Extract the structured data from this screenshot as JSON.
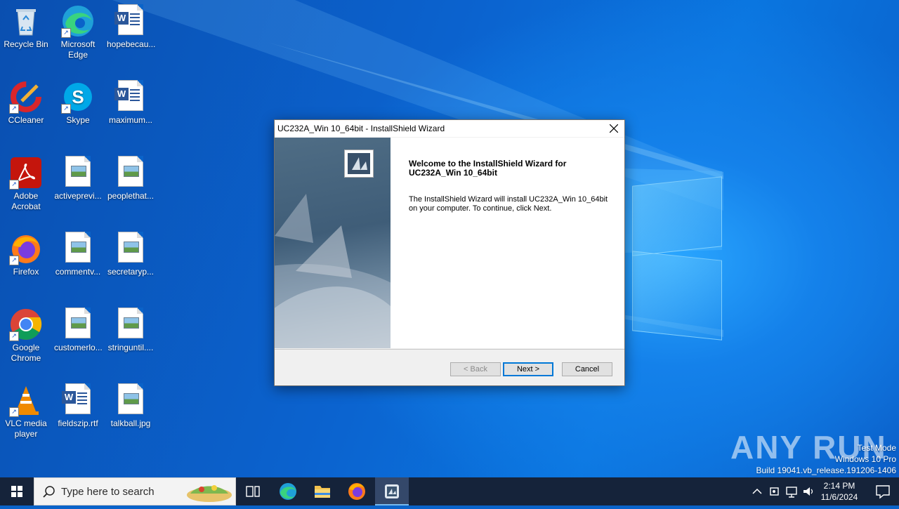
{
  "desktop": {
    "icons": [
      {
        "label": "Recycle Bin"
      },
      {
        "label": "Microsoft Edge"
      },
      {
        "label": "hopebecau..."
      },
      {
        "label": "CCleaner"
      },
      {
        "label": "Skype"
      },
      {
        "label": "maximum..."
      },
      {
        "label": "Adobe Acrobat"
      },
      {
        "label": "activeprevi..."
      },
      {
        "label": "peoplethat..."
      },
      {
        "label": "Firefox"
      },
      {
        "label": "commentv..."
      },
      {
        "label": "secretaryp..."
      },
      {
        "label": "Google Chrome"
      },
      {
        "label": "customerlo..."
      },
      {
        "label": "stringuntil...."
      },
      {
        "label": "VLC media player"
      },
      {
        "label": "fieldszip.rtf"
      },
      {
        "label": "talkball.jpg"
      }
    ]
  },
  "wizard": {
    "title": "UC232A_Win 10_64bit - InstallShield Wizard",
    "heading": "Welcome to the InstallShield Wizard for UC232A_Win 10_64bit",
    "body_line1": "The InstallShield Wizard will install UC232A_Win 10_64bit",
    "body_line2": "on your computer.  To continue, click Next.",
    "back_label": "< Back",
    "next_label": "Next >",
    "cancel_label": "Cancel"
  },
  "watermark": {
    "brand": "ANY RUN",
    "line1": "Test Mode",
    "line2": "Windows 10 Pro",
    "line3": "Build 19041.vb_release.191206-1406"
  },
  "taskbar": {
    "search_placeholder": "Type here to search",
    "time": "2:14 PM",
    "date": "11/6/2024"
  },
  "colors": {
    "desktop_blue": "#0a63c9",
    "taskbar_bg": "#15233a",
    "accent": "#0078d7"
  }
}
